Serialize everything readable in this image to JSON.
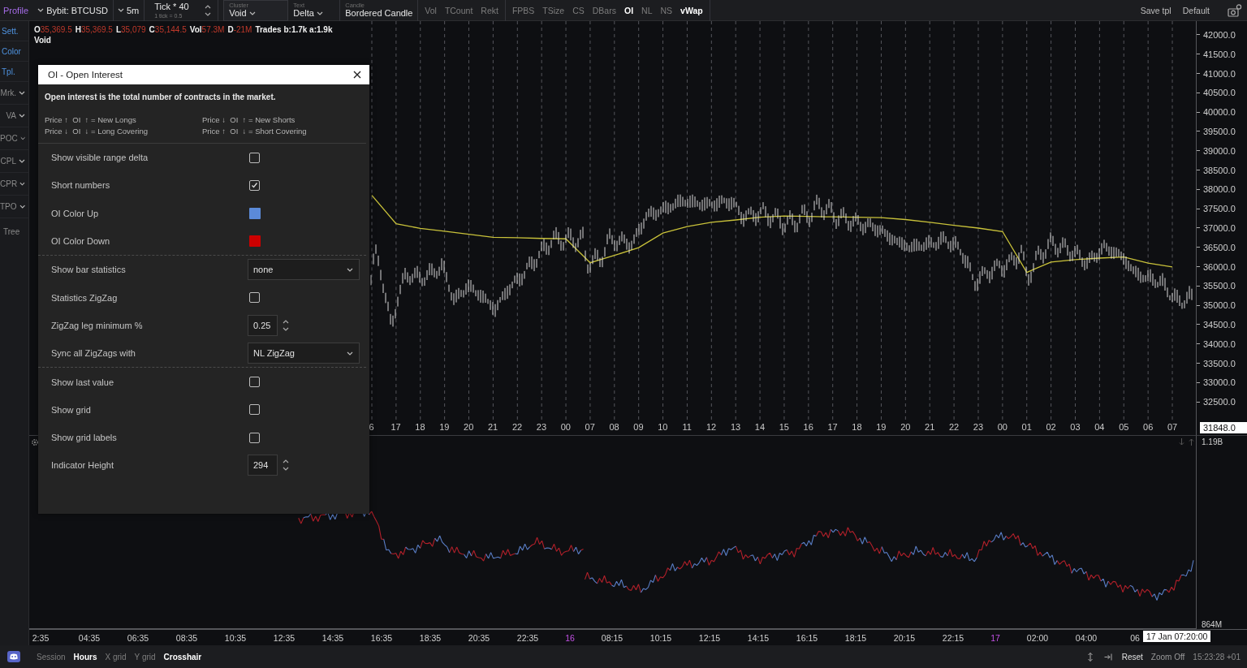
{
  "toolbar": {
    "profile": "Profile",
    "symbol": "Bybit: BTCUSD",
    "timeframe": "5m",
    "tick": {
      "value": "Tick * 40",
      "hint": "1 tick = 0.5"
    },
    "selects": [
      {
        "caption": "Cluster",
        "value": "Void"
      },
      {
        "caption": "Text",
        "value": "Delta"
      },
      {
        "caption": "Candle",
        "value": "Bordered Candle"
      }
    ],
    "toggle_groups": [
      [
        {
          "label": "Vol",
          "on": false
        },
        {
          "label": "TCount",
          "on": false
        },
        {
          "label": "Rekt",
          "on": false
        }
      ],
      [
        {
          "label": "FPBS",
          "on": false
        },
        {
          "label": "TSize",
          "on": false
        },
        {
          "label": "CS",
          "on": false
        },
        {
          "label": "DBars",
          "on": false
        },
        {
          "label": "OI",
          "on": true
        },
        {
          "label": "NL",
          "on": false
        },
        {
          "label": "NS",
          "on": false
        },
        {
          "label": "vWap",
          "on": true
        }
      ]
    ],
    "actions": [
      "Save tpl",
      "Default"
    ]
  },
  "sidebar": [
    {
      "label": "Sett.",
      "kind": "link"
    },
    {
      "label": "Color",
      "kind": "link"
    },
    {
      "label": "Tpl.",
      "kind": "link"
    },
    {
      "label": "Mrk.",
      "kind": "menu"
    },
    {
      "label": "VA",
      "kind": "menu"
    },
    {
      "label": "POC",
      "kind": "menu"
    },
    {
      "label": "CPL",
      "kind": "menu"
    },
    {
      "label": "CPR",
      "kind": "menu"
    },
    {
      "label": "TPO",
      "kind": "menu"
    },
    {
      "label": "Tree",
      "kind": "plain"
    }
  ],
  "legend": {
    "values": [
      {
        "key": "O",
        "value": "35,369.5"
      },
      {
        "key": "H",
        "value": "35,369.5"
      },
      {
        "key": "L",
        "value": "35,079"
      },
      {
        "key": "C",
        "value": "35,144.5"
      },
      {
        "key": "Vol",
        "value": "57.3M"
      },
      {
        "key": "D",
        "value": "-21M"
      }
    ],
    "trades": "Trades b:1.7k a:1.9k",
    "cluster": "Void"
  },
  "price_chart": {
    "chart_data": {
      "type": "line",
      "ylim": [
        31958,
        42357
      ],
      "grid": true,
      "categories": [
        "6",
        "17",
        "18",
        "19",
        "20",
        "21",
        "22",
        "23",
        "00",
        "07",
        "08",
        "09",
        "10",
        "11",
        "12",
        "13",
        "14",
        "15",
        "16",
        "17",
        "18",
        "19",
        "20",
        "21",
        "22",
        "23",
        "00",
        "01",
        "02",
        "03",
        "04",
        "05",
        "06",
        "07"
      ],
      "yticks": [
        {
          "value": 42000,
          "label": "42000.0"
        },
        {
          "value": 41500,
          "label": "41500.0"
        },
        {
          "value": 41000,
          "label": "41000.0"
        },
        {
          "value": 40500,
          "label": "40500.0"
        },
        {
          "value": 40000,
          "label": "40000.0"
        },
        {
          "value": 39500,
          "label": "39500.0"
        },
        {
          "value": 39000,
          "label": "39000.0"
        },
        {
          "value": 38500,
          "label": "38500.0"
        },
        {
          "value": 38000,
          "label": "38000.0"
        },
        {
          "value": 37500,
          "label": "37500.0"
        },
        {
          "value": 37000,
          "label": "37000.0"
        },
        {
          "value": 36500,
          "label": "36500.0"
        },
        {
          "value": 36000,
          "label": "36000.0"
        },
        {
          "value": 35500,
          "label": "35500.0"
        },
        {
          "value": 35000,
          "label": "35000.0"
        },
        {
          "value": 34500,
          "label": "34500.0"
        },
        {
          "value": 34000,
          "label": "34000.0"
        },
        {
          "value": 33500,
          "label": "33500.0"
        },
        {
          "value": 33000,
          "label": "33000.0"
        },
        {
          "value": 32500,
          "label": "32500.0"
        }
      ],
      "series": [
        {
          "color": "#c9c23a",
          "values": [
            37840,
            37100,
            36980,
            36910,
            36830,
            36750,
            36740,
            36720,
            36710,
            36090,
            36280,
            36480,
            36860,
            37030,
            37140,
            37200,
            37270,
            37300,
            37290,
            37280,
            37270,
            37260,
            37210,
            37140,
            37060,
            36990,
            36900,
            35840,
            36110,
            36170,
            36210,
            36240,
            36080,
            35980
          ]
        }
      ]
    }
  },
  "price_axis": {
    "cursor": "31848.0"
  },
  "indicator_axis": {
    "top": "1.19B",
    "bottom": "864M"
  },
  "time_axis": {
    "labels": [
      {
        "text": "2:35",
        "kind": "time"
      },
      {
        "text": "04:35",
        "kind": "time"
      },
      {
        "text": "06:35",
        "kind": "time"
      },
      {
        "text": "08:35",
        "kind": "time"
      },
      {
        "text": "10:35",
        "kind": "time"
      },
      {
        "text": "12:35",
        "kind": "time"
      },
      {
        "text": "14:35",
        "kind": "time"
      },
      {
        "text": "16:35",
        "kind": "time"
      },
      {
        "text": "18:35",
        "kind": "time"
      },
      {
        "text": "20:35",
        "kind": "time"
      },
      {
        "text": "22:35",
        "kind": "time"
      },
      {
        "text": "16",
        "kind": "day"
      },
      {
        "text": "08:15",
        "kind": "time"
      },
      {
        "text": "10:15",
        "kind": "time"
      },
      {
        "text": "12:15",
        "kind": "time"
      },
      {
        "text": "14:15",
        "kind": "time"
      },
      {
        "text": "16:15",
        "kind": "time"
      },
      {
        "text": "18:15",
        "kind": "time"
      },
      {
        "text": "20:15",
        "kind": "time"
      },
      {
        "text": "22:15",
        "kind": "time"
      },
      {
        "text": "17",
        "kind": "day"
      },
      {
        "text": "02:00",
        "kind": "time"
      },
      {
        "text": "04:00",
        "kind": "time"
      },
      {
        "text": "06",
        "kind": "time"
      }
    ],
    "cursor": "17 Jan 07:20:00"
  },
  "dialog": {
    "title": "OI - Open Interest",
    "description": "Open interest is the total number of contracts in the market.",
    "legend": [
      "Price ↑  OI  ↑ = New Longs",
      "Price ↓  OI  ↑ = New Shorts",
      "Price ↓  OI  ↓ = Long Covering",
      "Price ↑  OI  ↓ = Short Covering"
    ],
    "sections": [
      [
        {
          "label": "Show visible range delta",
          "kind": "checkbox",
          "checked": false
        },
        {
          "label": "Short numbers",
          "kind": "checkbox",
          "checked": true
        },
        {
          "label": "OI Color Up",
          "kind": "color",
          "color": "#5b8ad8"
        },
        {
          "label": "OI Color Down",
          "kind": "color",
          "color": "#cc0000"
        }
      ],
      [
        {
          "label": "Show bar statistics",
          "kind": "select",
          "value": "none"
        },
        {
          "label": "Statistics ZigZag",
          "kind": "checkbox",
          "checked": false
        },
        {
          "label": "ZigZag leg minimum %",
          "kind": "number",
          "value": "0.25"
        },
        {
          "label": "Sync all ZigZags with",
          "kind": "select",
          "value": "NL ZigZag"
        }
      ],
      [
        {
          "label": "Show last value",
          "kind": "checkbox",
          "checked": false
        },
        {
          "label": "Show grid",
          "kind": "checkbox",
          "checked": false
        },
        {
          "label": "Show grid labels",
          "kind": "checkbox",
          "checked": false
        },
        {
          "label": "Indicator Height",
          "kind": "number",
          "value": "294"
        }
      ]
    ]
  },
  "status_bar": {
    "items": [
      {
        "label": "Session",
        "on": false
      },
      {
        "label": "Hours",
        "on": true
      },
      {
        "label": "X grid",
        "on": false
      },
      {
        "label": "Y grid",
        "on": false
      },
      {
        "label": "Crosshair",
        "on": true
      }
    ],
    "actions": [
      "Reset",
      "Zoom Off"
    ],
    "clock": "15:23:28 +01"
  }
}
